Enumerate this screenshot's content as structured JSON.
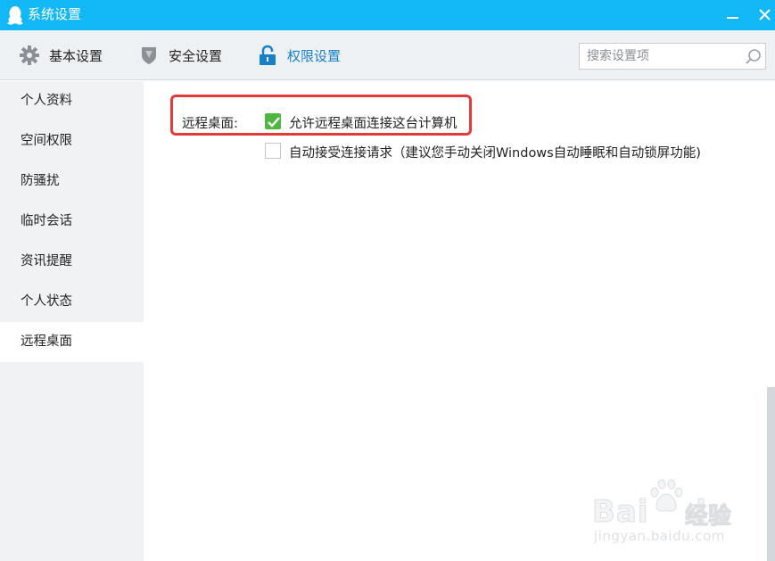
{
  "window": {
    "title": "系统设置",
    "accent_color": "#12b7f5",
    "icons": {
      "app": "qq-penguin-icon",
      "minimize": "minimize-icon",
      "close": "close-icon"
    }
  },
  "toolbar": {
    "tabs": [
      {
        "label": "基本设置",
        "icon": "gear-icon",
        "active": false
      },
      {
        "label": "安全设置",
        "icon": "shield-icon",
        "active": false
      },
      {
        "label": "权限设置",
        "icon": "lock-icon",
        "active": true
      }
    ],
    "search": {
      "placeholder": "搜索设置项",
      "value": "",
      "icon": "search-icon"
    }
  },
  "sidebar": {
    "items": [
      {
        "label": "个人资料",
        "active": false
      },
      {
        "label": "空间权限",
        "active": false
      },
      {
        "label": "防骚扰",
        "active": false
      },
      {
        "label": "临时会话",
        "active": false
      },
      {
        "label": "资讯提醒",
        "active": false
      },
      {
        "label": "个人状态",
        "active": false
      },
      {
        "label": "远程桌面",
        "active": true
      }
    ]
  },
  "content": {
    "section_label": "远程桌面:",
    "options": [
      {
        "label": "允许远程桌面连接这台计算机",
        "checked": true
      },
      {
        "label": "自动接受连接请求（建议您手动关闭Windows自动睡眠和自动锁屏功能)",
        "checked": false
      }
    ],
    "highlight_color": "#e33a3a",
    "check_color": "#4fb640"
  },
  "watermark": {
    "brand": "Bai",
    "brand_suffix": "du",
    "cn": "经验",
    "url": "jingyan.baidu.com"
  }
}
